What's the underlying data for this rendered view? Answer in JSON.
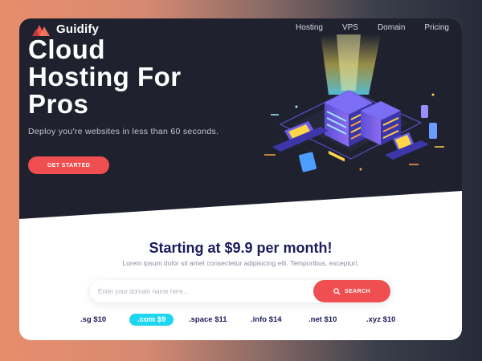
{
  "brand": {
    "name": "Guidify"
  },
  "nav": {
    "items": [
      "Hosting",
      "VPS",
      "Domain",
      "Pricing"
    ]
  },
  "hero": {
    "title_lines": [
      "Cloud",
      "Hosting For",
      "Pros"
    ],
    "subtitle": "Deploy you're websites in less than 60 seconds.",
    "cta_label": "GET STARTED"
  },
  "pricing": {
    "headline": "Starting at $9.9 per month!",
    "description": "Lorem ipsum dolor sit amet consectetur adipisicing elit. Temporibus, excepturi."
  },
  "search": {
    "placeholder": "Enter your domain name here...",
    "button_label": "SEARCH",
    "button_icon": "search-icon"
  },
  "tlds": [
    {
      "label": ".sg $10",
      "active": false
    },
    {
      "label": ".com $9",
      "active": true
    },
    {
      "label": ".space $11",
      "active": false
    },
    {
      "label": ".info $14",
      "active": false
    },
    {
      "label": ".net $10",
      "active": false
    },
    {
      "label": ".xyz $10",
      "active": false
    }
  ],
  "colors": {
    "hero_bg": "#1f222e",
    "accent": "#ef4f50",
    "highlight": "#1ed6f0",
    "headline": "#1b1b5e"
  }
}
